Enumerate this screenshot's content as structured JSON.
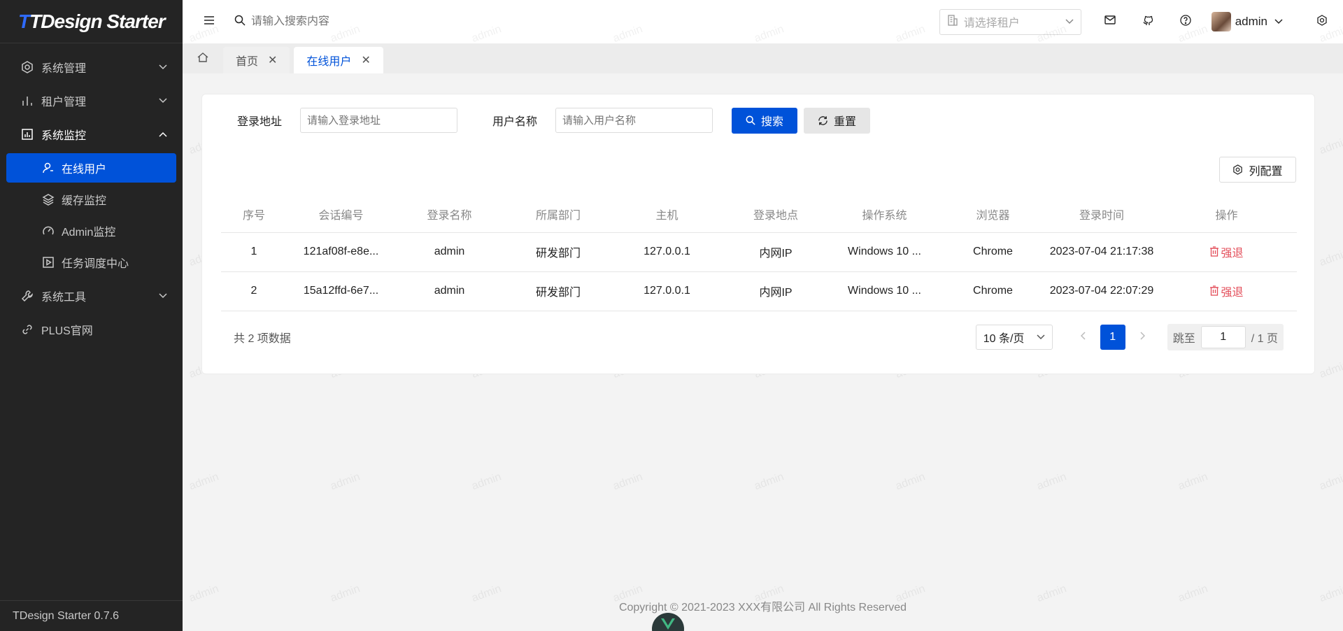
{
  "sidebar": {
    "logo_prefix": "T",
    "logo_text": "TDesign Starter",
    "items": [
      {
        "label": "系统管理",
        "icon": "settings-icon"
      },
      {
        "label": "租户管理",
        "icon": "chart-bar-icon"
      },
      {
        "label": "系统监控",
        "icon": "monitor-icon"
      },
      {
        "label": "系统工具",
        "icon": "wrench-icon"
      },
      {
        "label": "PLUS官网",
        "icon": "link-icon"
      }
    ],
    "sub_items": [
      {
        "label": "在线用户",
        "icon": "user-online-icon"
      },
      {
        "label": "缓存监控",
        "icon": "layers-icon"
      },
      {
        "label": "Admin监控",
        "icon": "dashboard-icon"
      },
      {
        "label": "任务调度中心",
        "icon": "play-icon"
      }
    ],
    "footer": "TDesign Starter 0.7.6"
  },
  "header": {
    "search_placeholder": "请输入搜索内容",
    "tenant_placeholder": "请选择租户",
    "user_name": "admin"
  },
  "tabs": [
    {
      "label": "首页"
    },
    {
      "label": "在线用户"
    }
  ],
  "filters": {
    "login_address_label": "登录地址",
    "login_address_placeholder": "请输入登录地址",
    "user_name_label": "用户名称",
    "user_name_placeholder": "请输入用户名称",
    "search_button": "搜索",
    "reset_button": "重置",
    "column_config_button": "列配置"
  },
  "table": {
    "columns": [
      "序号",
      "会话编号",
      "登录名称",
      "所属部门",
      "主机",
      "登录地点",
      "操作系统",
      "浏览器",
      "登录时间",
      "操作"
    ],
    "rows": [
      [
        "1",
        "121af08f-e8e...",
        "admin",
        "研发部门",
        "127.0.0.1",
        "内网IP",
        "Windows 10 ...",
        "Chrome",
        "2023-07-04 21:17:38",
        "强退"
      ],
      [
        "2",
        "15a12ffd-6e7...",
        "admin",
        "研发部门",
        "127.0.0.1",
        "内网IP",
        "Windows 10 ...",
        "Chrome",
        "2023-07-04 22:07:29",
        "强退"
      ]
    ]
  },
  "pagination": {
    "total_text": "共 2 项数据",
    "page_size": "10 条/页",
    "current_page": "1",
    "jump_label": "跳至",
    "jump_value": "1",
    "total_pages": "/ 1 页"
  },
  "footer": {
    "copyright": "Copyright © 2021-2023 XXX有限公司 All Rights Reserved"
  },
  "watermark_text": "admin",
  "colors": {
    "primary": "#0052d9",
    "sidebar_bg": "#242424",
    "danger": "#e34d59"
  }
}
